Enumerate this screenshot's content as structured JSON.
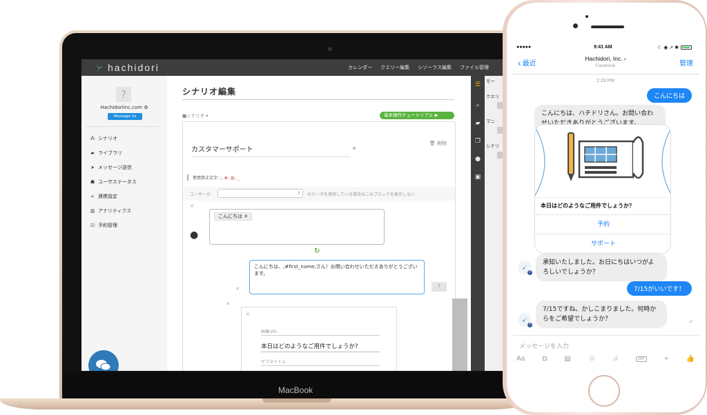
{
  "laptop": {
    "brand": "MacBook"
  },
  "app": {
    "logo": "hachidori",
    "nav": [
      "カレンダー",
      "クエリー編集",
      "シソーラス編集",
      "ファイル管理"
    ],
    "sidebar": {
      "avatar_placeholder": "?",
      "account_name": "Hachidoriinc.com",
      "message_us": "Message Us",
      "items": [
        {
          "icon": "sitemap-icon",
          "glyph": "⁂",
          "label": "シナリオ"
        },
        {
          "icon": "book-icon",
          "glyph": "▰",
          "label": "ライブラリ"
        },
        {
          "icon": "send-icon",
          "glyph": "➤",
          "label": "メッセージ送信"
        },
        {
          "icon": "users-icon",
          "glyph": "☗",
          "label": "ユーザステータス"
        },
        {
          "icon": "link-icon",
          "glyph": "∞",
          "label": "連携設定"
        },
        {
          "icon": "bar-chart-icon",
          "glyph": "▥",
          "label": "アナリティクス"
        },
        {
          "icon": "calendar-check-icon",
          "glyph": "☑",
          "label": "予約管理"
        }
      ],
      "chat_badge": "0"
    },
    "main": {
      "page_title": "シナリオ編集",
      "scenario_label": "■シナリオ ▾",
      "tutorial_button": "基本操作チュートリアル ▶",
      "scenario_name": "カスタマーサポート",
      "delete_label": "🗑 削除",
      "forbidden_label": "使用禁止文字:",
      "forbidden_chars": ";, #, @, _",
      "condition_user": "ユーザーが",
      "condition_note": "のデータを保持している場合はこのブロックを表示しない",
      "user_tag": "こんにちは",
      "bot_reply": "こんにちは、;#first_name;さん！お問い合わせいただきありがとうございます。",
      "question_mark": "?",
      "image_url_label": "画像URL",
      "card_title": "本日はどのようなご用件でしょうか?",
      "subtitle_label": "サブタイトル"
    },
    "right_panel": [
      "モー",
      "クエリ",
      "マニ",
      "シナリ"
    ]
  },
  "phone": {
    "status": {
      "carrier": "●●●●● ",
      "time": "9:41 AM",
      "right": "☾ ◉ ➚ ✱"
    },
    "header": {
      "back": "最近",
      "page_name": "Hachidori, Inc. ›",
      "page_sub": "Facebook",
      "manage": "管理"
    },
    "timestamp": "2:26 PM",
    "messages": {
      "out1": "こんにちは",
      "in1": "こんにちは、ハチドリさん。お問い合わせいただきありがとうございます。",
      "card_title": "本日はどのようなご用件でしょうか？",
      "card_btn1": "予約",
      "card_btn2": "サポート",
      "in2": "承知いたしました。お日にちはいつがよろしいでしょうか？",
      "out2": "7/15がいいです！",
      "in3": "7/15ですね。かしこまりました。何時からをご希望でしょうか？"
    },
    "input_placeholder": "メッセージを入力",
    "toolbar": {
      "aa": "Aa",
      "gif": "GIF"
    },
    "colors": {
      "messenger_blue": "#1e86f5",
      "incoming_bubble": "#ededed"
    }
  },
  "colors": {
    "header_bg": "#3d3d3d",
    "tutorial_green": "#5ab33e",
    "accent_blue": "#1f8fe0"
  }
}
